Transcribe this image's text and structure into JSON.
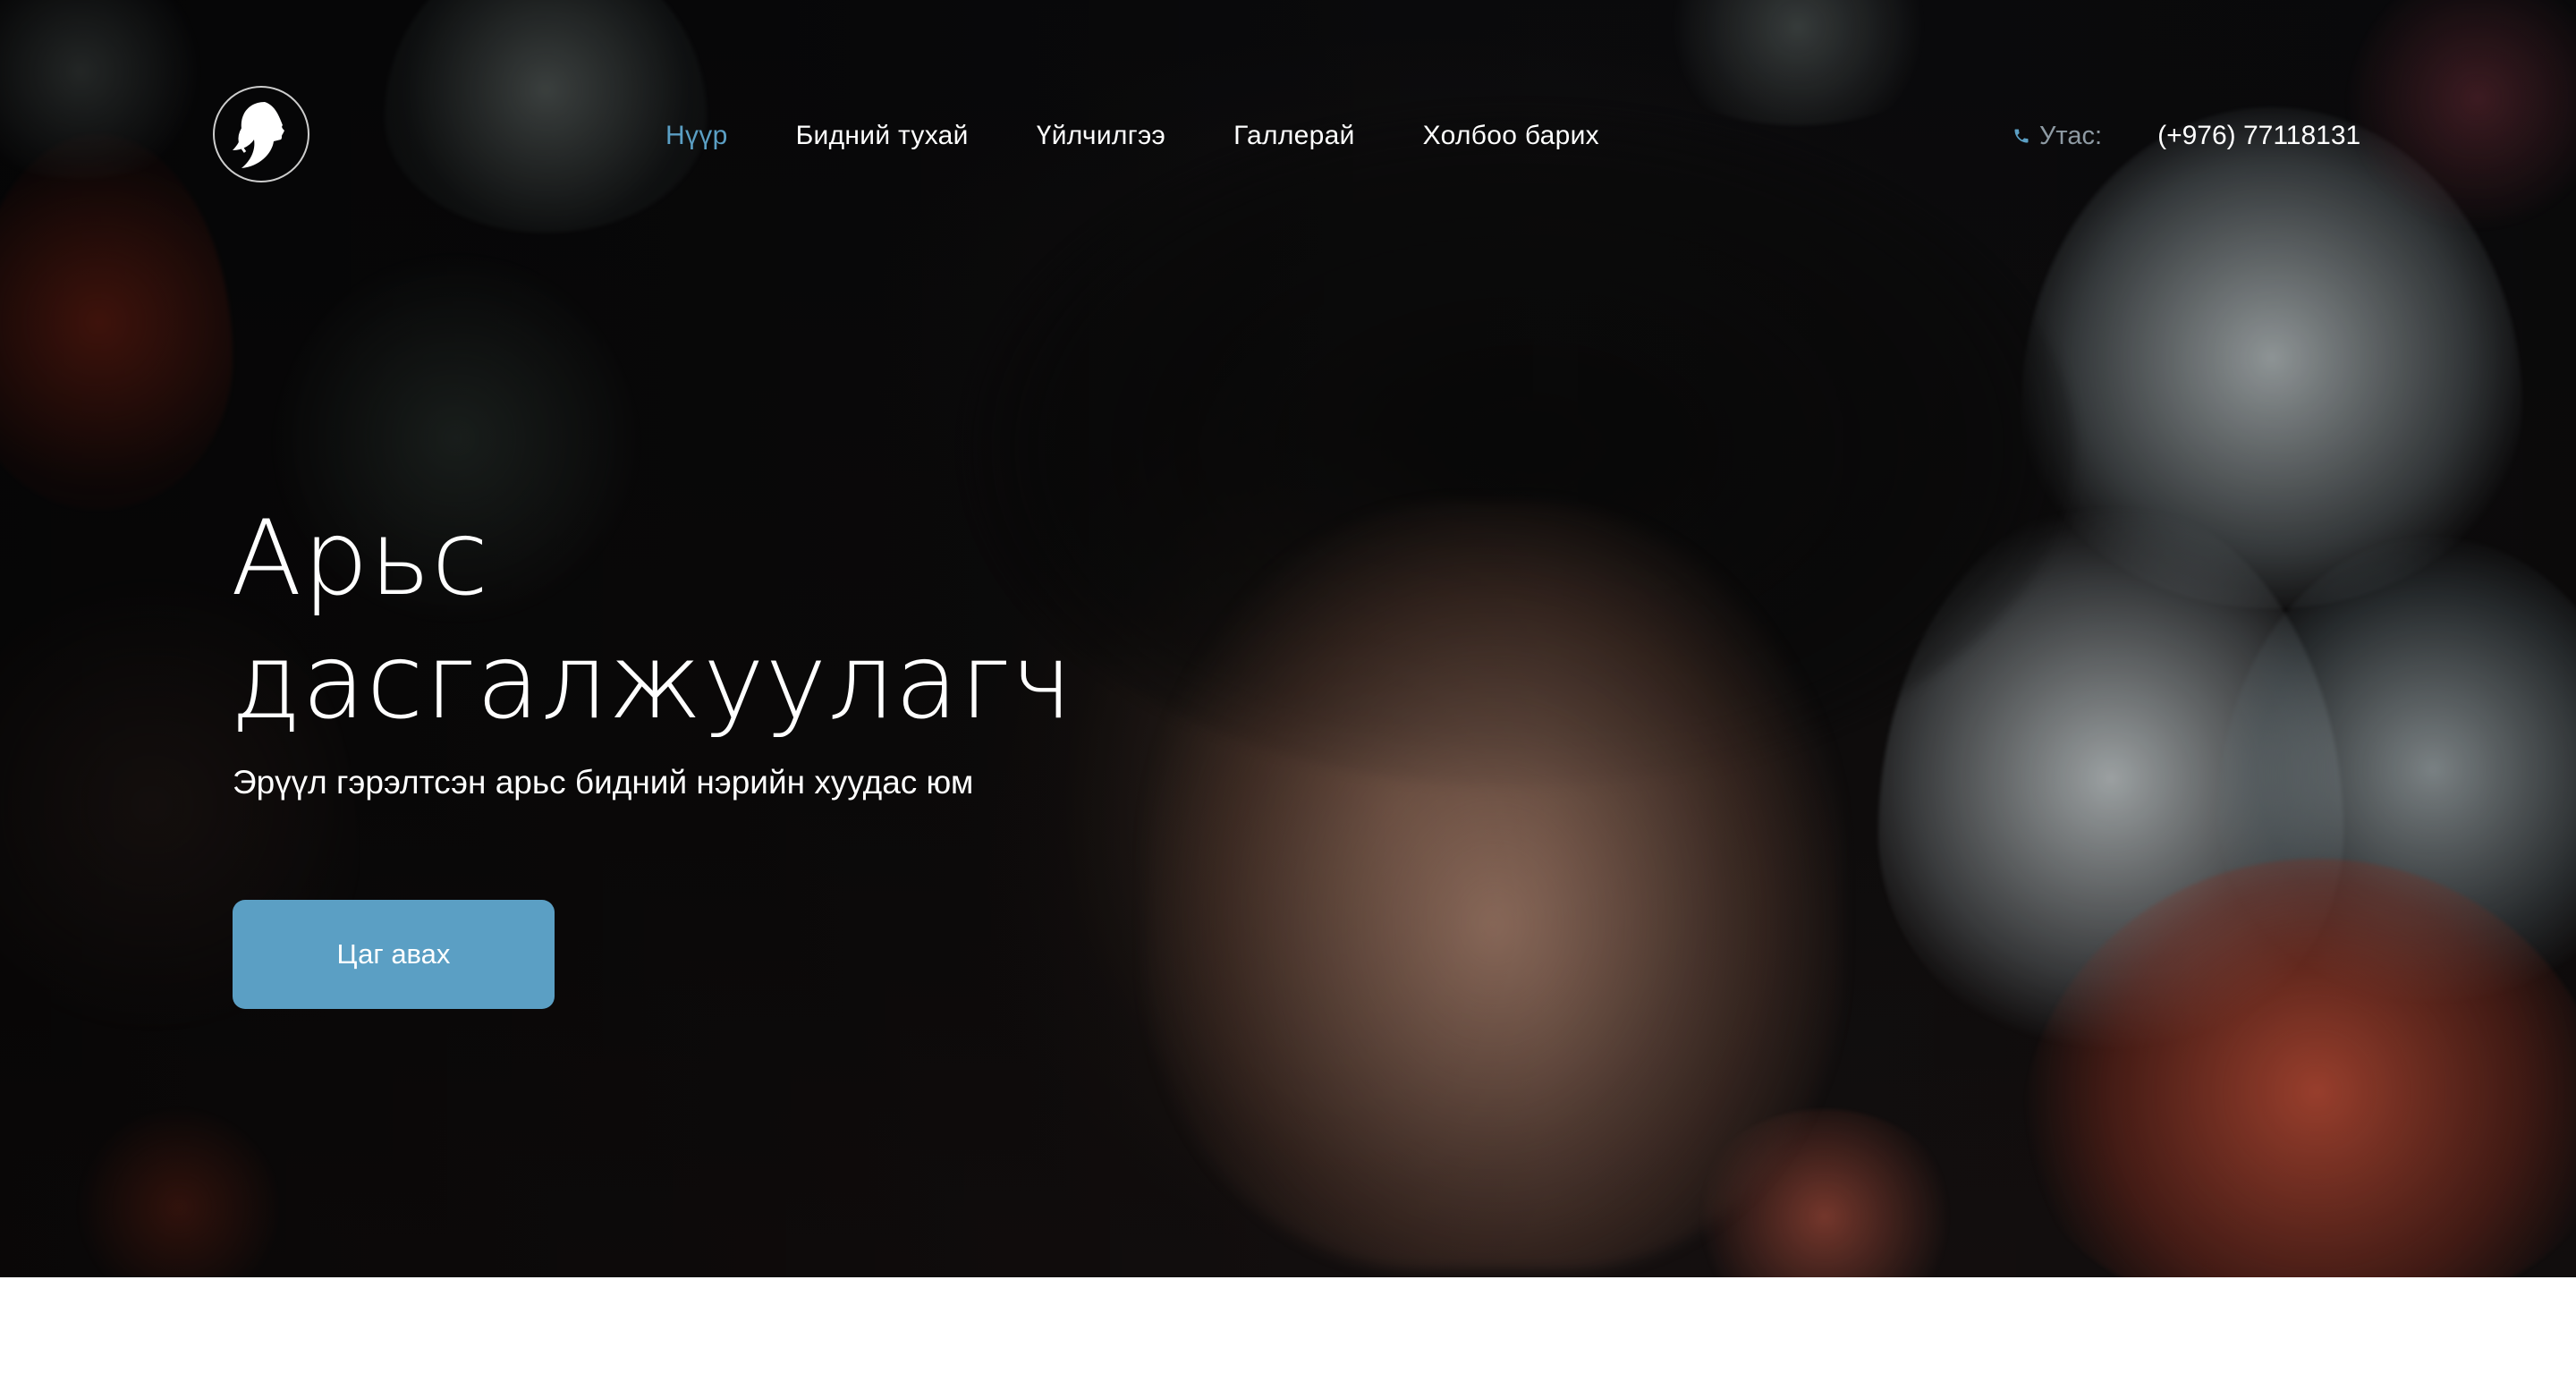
{
  "colors": {
    "accent": "#5b9fc4",
    "nav_text": "#ffffff",
    "phone_label": "#8e9aa3"
  },
  "header": {
    "logo_icon": "woman-silhouette-icon",
    "nav": [
      {
        "label": "Нүүр",
        "active": true
      },
      {
        "label": "Бидний тухай",
        "active": false
      },
      {
        "label": "Үйлчилгээ",
        "active": false
      },
      {
        "label": "Галлерай",
        "active": false
      },
      {
        "label": "Холбоо барих",
        "active": false
      }
    ],
    "phone": {
      "icon": "phone-icon",
      "label": "Утас:",
      "number": "(+976) 77118131"
    }
  },
  "hero": {
    "title_line1": "Арьс",
    "title_line2": "дасгалжуулагч",
    "subtitle": "Эрүүл гэрэлтсэн арьс бидний нэрийн хуудас юм",
    "cta_label": "Цаг авах"
  }
}
